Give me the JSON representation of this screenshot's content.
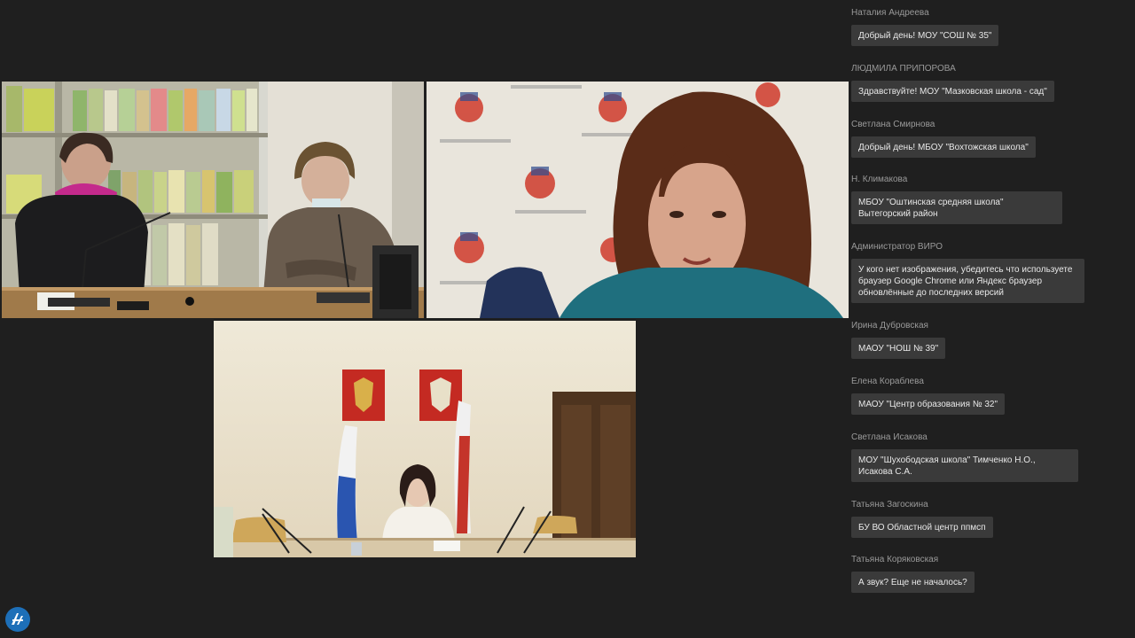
{
  "video": {
    "tiles": [
      {
        "label": "participant-room-library",
        "icon": "video-feed"
      },
      {
        "label": "participant-speaker",
        "icon": "video-feed"
      },
      {
        "label": "participant-conference-hall",
        "icon": "video-feed"
      }
    ]
  },
  "chat": {
    "messages": [
      {
        "author": "Наталия Андреева",
        "text": "Добрый день! МОУ \"СОШ № 35\""
      },
      {
        "author": "ЛЮДМИЛА ПРИПОРОВА",
        "text": "Здравствуйте! МОУ \"Мазковская школа - сад\""
      },
      {
        "author": "Светлана Смирнова",
        "text": "Добрый день! МБОУ \"Вохтожская школа\""
      },
      {
        "author": "Н. Климакова",
        "text": "МБОУ \"Оштинская средняя школа\" Вытегорский район"
      },
      {
        "author": "Администратор ВИРО",
        "text": "У кого нет изображения, убедитесь что используете браузер Google Chrome или Яндекс браузер обновлённые до последних версий"
      },
      {
        "author": "Ирина Дубровская",
        "text": "МАОУ \"НОШ № 39\""
      },
      {
        "author": "Елена Кораблева",
        "text": "МАОУ \"Центр образования № 32\""
      },
      {
        "author": "Светлана Исакова",
        "text": "МОУ \"Шухободская школа\" Тимченко Н.О., Исакова С.А."
      },
      {
        "author": "Татьяна Загоскина",
        "text": "БУ ВО Областной центр ппмсп"
      },
      {
        "author": "Татьяна Коряковская",
        "text": "А звук? Еще не началось?"
      }
    ]
  },
  "brand": {
    "icon": "platform-logo-icon",
    "color": "#1d6fb8"
  }
}
